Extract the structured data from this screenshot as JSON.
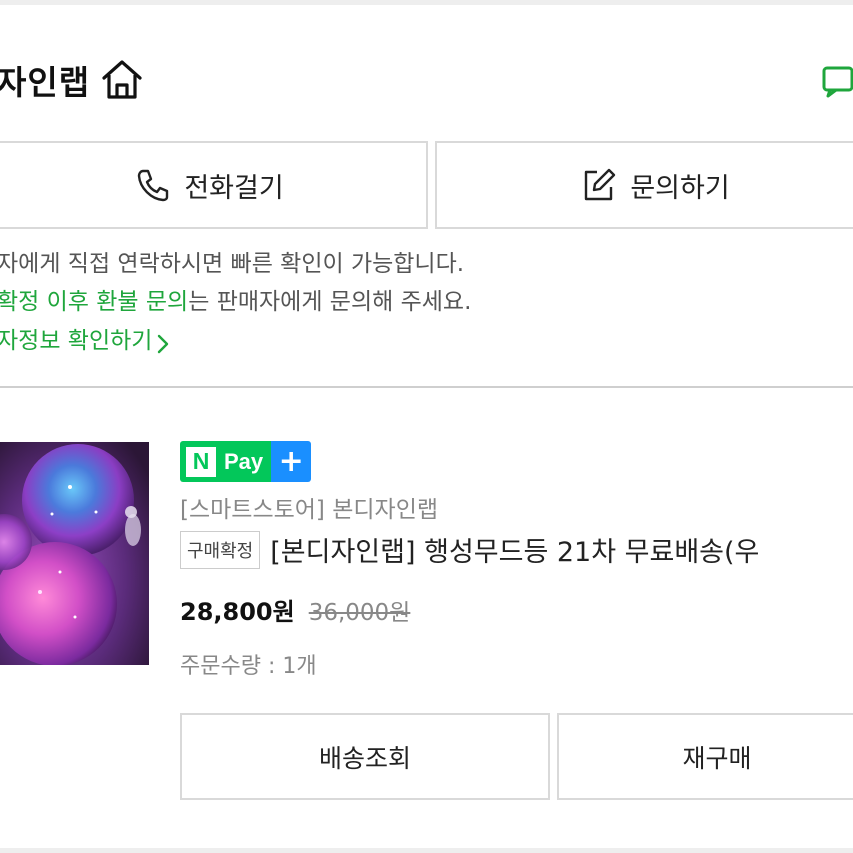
{
  "header": {
    "store_name": "자인랩",
    "home_icon": "home-icon",
    "chat_icon": "chat-icon",
    "accent_color": "#1fa63c"
  },
  "actions": {
    "call_label": "전화걸기",
    "call_icon": "phone-icon",
    "inquiry_label": "문의하기",
    "inquiry_icon": "edit-icon"
  },
  "notice": {
    "line1": "자에게 직접 연락하시면 빠른 확인이 가능합니다.",
    "line2_highlight": "확정 이후 환불 문의",
    "line2_rest": "는 판매자에게 문의해 주세요.",
    "seller_info_link": "자정보 확인하기"
  },
  "order": {
    "badge": {
      "n": "N",
      "pay": "Pay",
      "plus": "+"
    },
    "store": "[스마트스토어] 본디자인랩",
    "status": "구매확정",
    "title": "[본디자인랩] 행성무드등 21차 무료배송(우",
    "price": "28,800원",
    "original_price": "36,000원",
    "quantity": "주문수량 : 1개",
    "shipping_button": "배송조회",
    "rebuy_button": "재구매"
  }
}
